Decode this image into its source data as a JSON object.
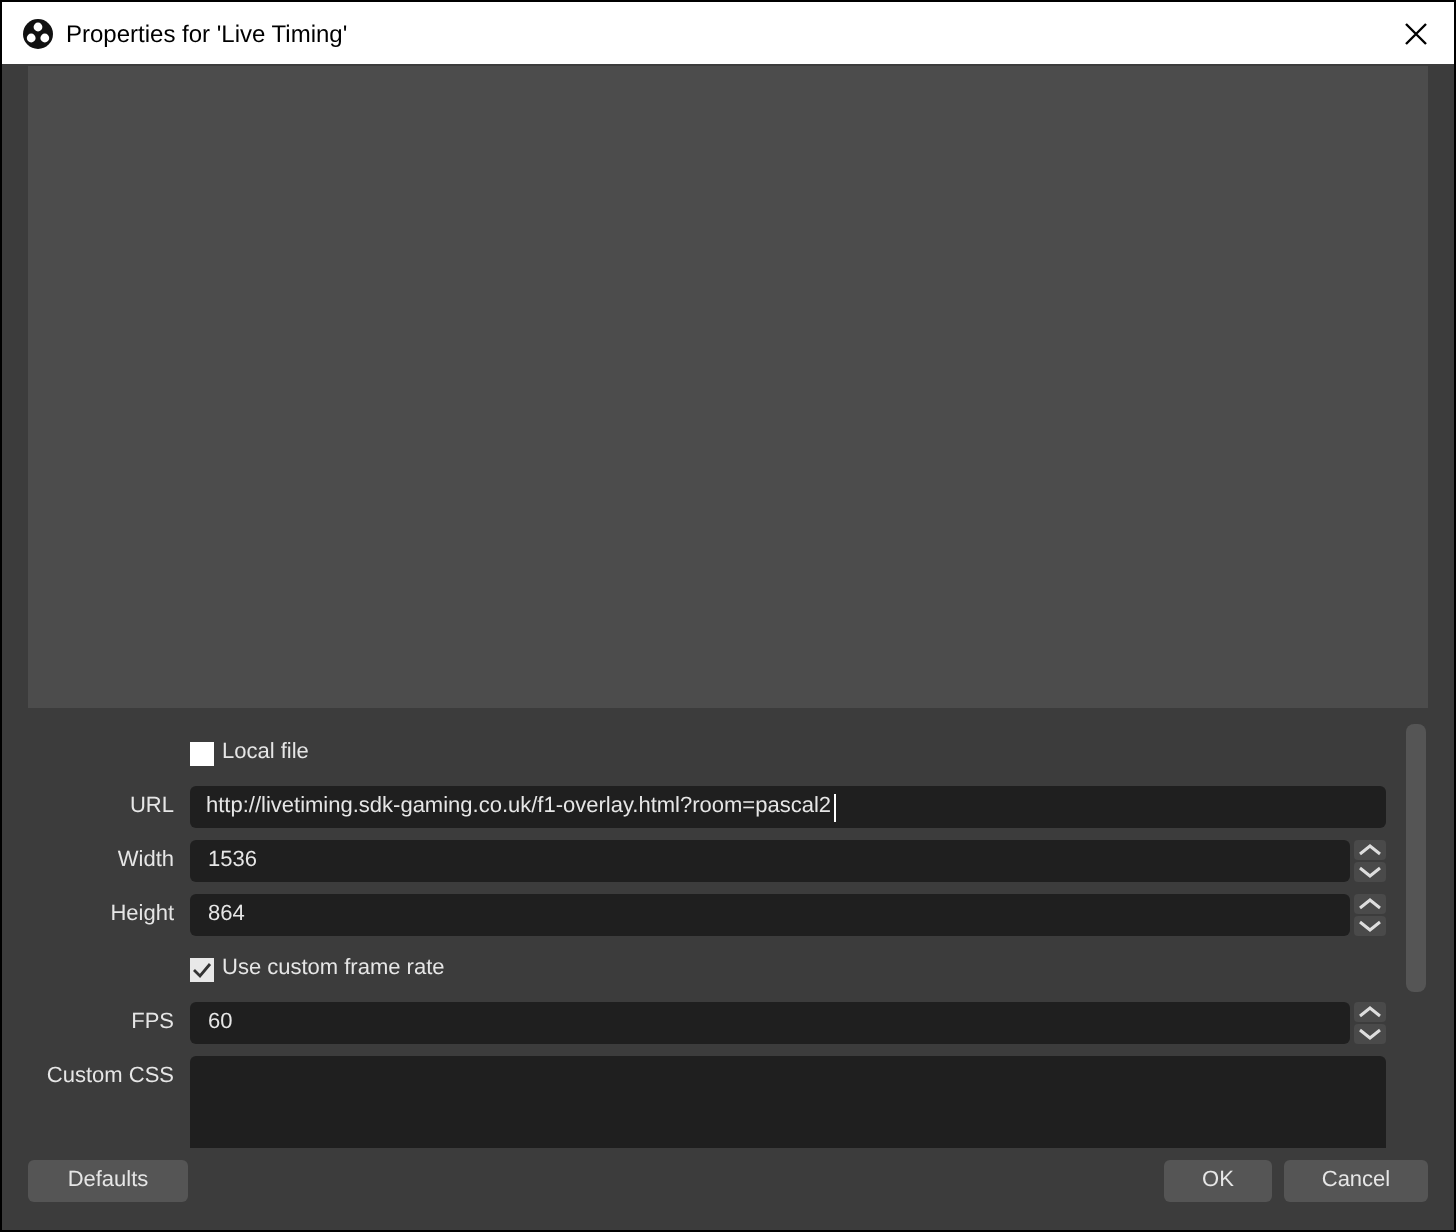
{
  "window": {
    "title": "Properties for 'Live Timing'"
  },
  "properties": [
    {
      "kind": "checkbox",
      "label": "Local file",
      "checked": false
    },
    {
      "kind": "text",
      "label": "URL",
      "value": "http://livetiming.sdk-gaming.co.uk/f1-overlay.html?room=pascal2",
      "focused": true
    },
    {
      "kind": "spin",
      "label": "Width",
      "value": "1536"
    },
    {
      "kind": "spin",
      "label": "Height",
      "value": "864"
    },
    {
      "kind": "checkbox",
      "label": "Use custom frame rate",
      "checked": true
    },
    {
      "kind": "spin",
      "label": "FPS",
      "value": "60"
    },
    {
      "kind": "textarea",
      "label": "Custom CSS"
    }
  ],
  "buttons": {
    "left": [
      "Defaults"
    ],
    "right": [
      "OK",
      "Cancel"
    ]
  }
}
